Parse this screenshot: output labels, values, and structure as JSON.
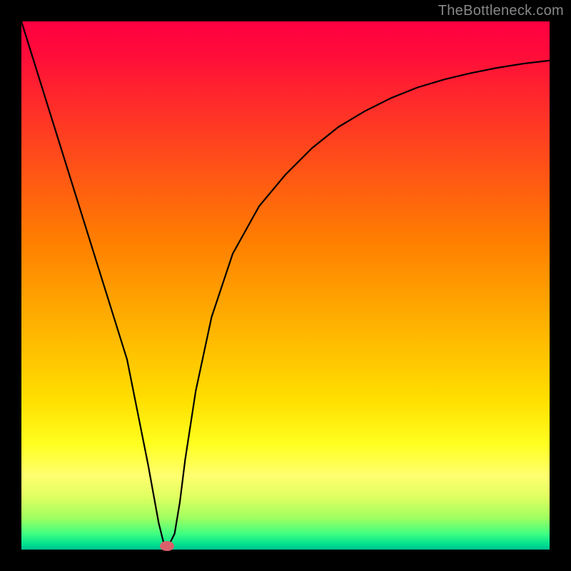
{
  "watermark": "TheBottleneck.com",
  "chart_data": {
    "type": "line",
    "title": "",
    "xlabel": "",
    "ylabel": "",
    "xlim": [
      0,
      100
    ],
    "ylim": [
      0,
      100
    ],
    "series": [
      {
        "name": "curve",
        "x": [
          0,
          5,
          10,
          15,
          20,
          24,
          26,
          27,
          28,
          29,
          30,
          31,
          33,
          36,
          40,
          45,
          50,
          55,
          60,
          65,
          70,
          75,
          80,
          85,
          90,
          95,
          100
        ],
        "values": [
          100,
          84,
          68,
          52,
          36,
          16,
          5,
          1,
          1,
          3,
          9,
          17,
          30,
          44,
          56,
          65,
          71,
          76,
          80,
          83,
          85.5,
          87.5,
          89,
          90.2,
          91.2,
          92,
          92.6
        ]
      }
    ],
    "marker": {
      "x": 27.5,
      "y": 0.7,
      "color": "#d9606a"
    },
    "gradient_stops": [
      {
        "pos": 0,
        "color": "#ff0040"
      },
      {
        "pos": 50,
        "color": "#ffb000"
      },
      {
        "pos": 82,
        "color": "#ffff40"
      },
      {
        "pos": 100,
        "color": "#00d090"
      }
    ]
  }
}
